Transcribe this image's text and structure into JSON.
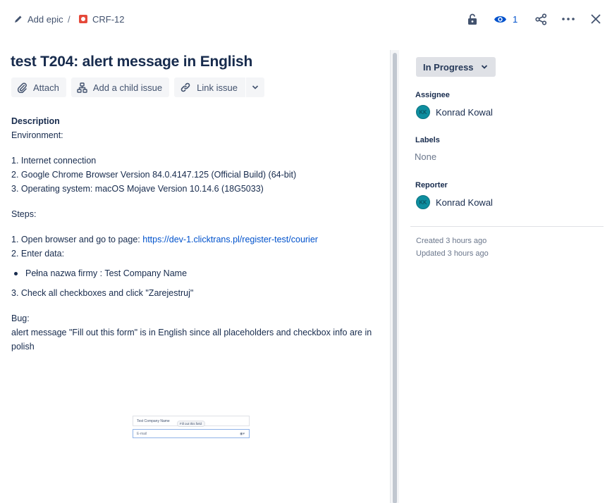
{
  "breadcrumb": {
    "add_epic": "Add epic",
    "separator": "/",
    "issue_key": "CRF-12"
  },
  "header": {
    "watch_count": "1",
    "icons": [
      "lock-icon",
      "eye-icon",
      "share-icon",
      "more-icon",
      "close-icon"
    ]
  },
  "issue": {
    "title": "test T204: alert message in English"
  },
  "toolbar": {
    "attach_label": "Attach",
    "add_child_label": "Add a child issue",
    "link_issue_label": "Link issue"
  },
  "description": {
    "heading": "Description",
    "environment_label": "Environment:",
    "env_items": [
      "1. Internet connection",
      "2. Google Chrome Browser Version 84.0.4147.125 (Official Build) (64-bit)",
      "3. Operating system: macOS Mojave Version 10.14.6 (18G5033)"
    ],
    "steps_label": "Steps:",
    "step1_prefix": "1. Open browser and go to page: ",
    "step1_link": "https://dev-1.clicktrans.pl/register-test/courier",
    "step2": "2. Enter data:",
    "bullet": "Pełna nazwa firmy : Test Company Name",
    "step3": "3. Check all checkboxes and click \"Zarejestruj\"",
    "bug_label": "Bug:",
    "bug_text": "alert message \"Fill out this form\" is in English   since all placeholders and checkbox info are in polish"
  },
  "attachment": {
    "field1": "Test Company Name",
    "tooltip": "Fill out this field",
    "field2": "E-mail"
  },
  "sidebar": {
    "status": "In Progress",
    "assignee_label": "Assignee",
    "assignee_initials": "KK",
    "assignee_name": "Konrad Kowal",
    "labels_label": "Labels",
    "labels_value": "None",
    "reporter_label": "Reporter",
    "reporter_initials": "KK",
    "reporter_name": "Konrad Kowal",
    "created": "Created 3 hours ago",
    "updated": "Updated 3 hours ago"
  },
  "colors": {
    "link": "#0052cc",
    "bug_icon": "#e5493a",
    "avatar": "#0e8e9f"
  }
}
